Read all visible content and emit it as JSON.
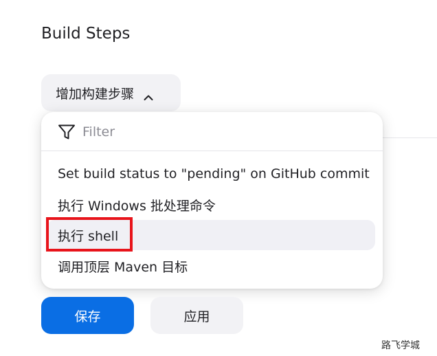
{
  "section": {
    "title": "Build Steps"
  },
  "add_step": {
    "label": "增加构建步骤",
    "icon": "chevron-up-icon"
  },
  "filter": {
    "placeholder": "Filter",
    "value": "",
    "icon": "filter-icon"
  },
  "menu": {
    "items": [
      {
        "label": "Set build status to \"pending\" on GitHub commit"
      },
      {
        "label": "执行 Windows 批处理命令"
      },
      {
        "label": "执行 shell",
        "highlighted": true
      },
      {
        "label": "调用顶层 Maven 目标"
      }
    ]
  },
  "actions": {
    "save_label": "保存",
    "apply_label": "应用"
  },
  "watermark": {
    "text": "路飞学城"
  },
  "colors": {
    "primary": "#0a6ee4",
    "annotation_box": "#e8141b",
    "hover_bg": "#f0f0f5",
    "button_bg": "#f2f2f5"
  }
}
